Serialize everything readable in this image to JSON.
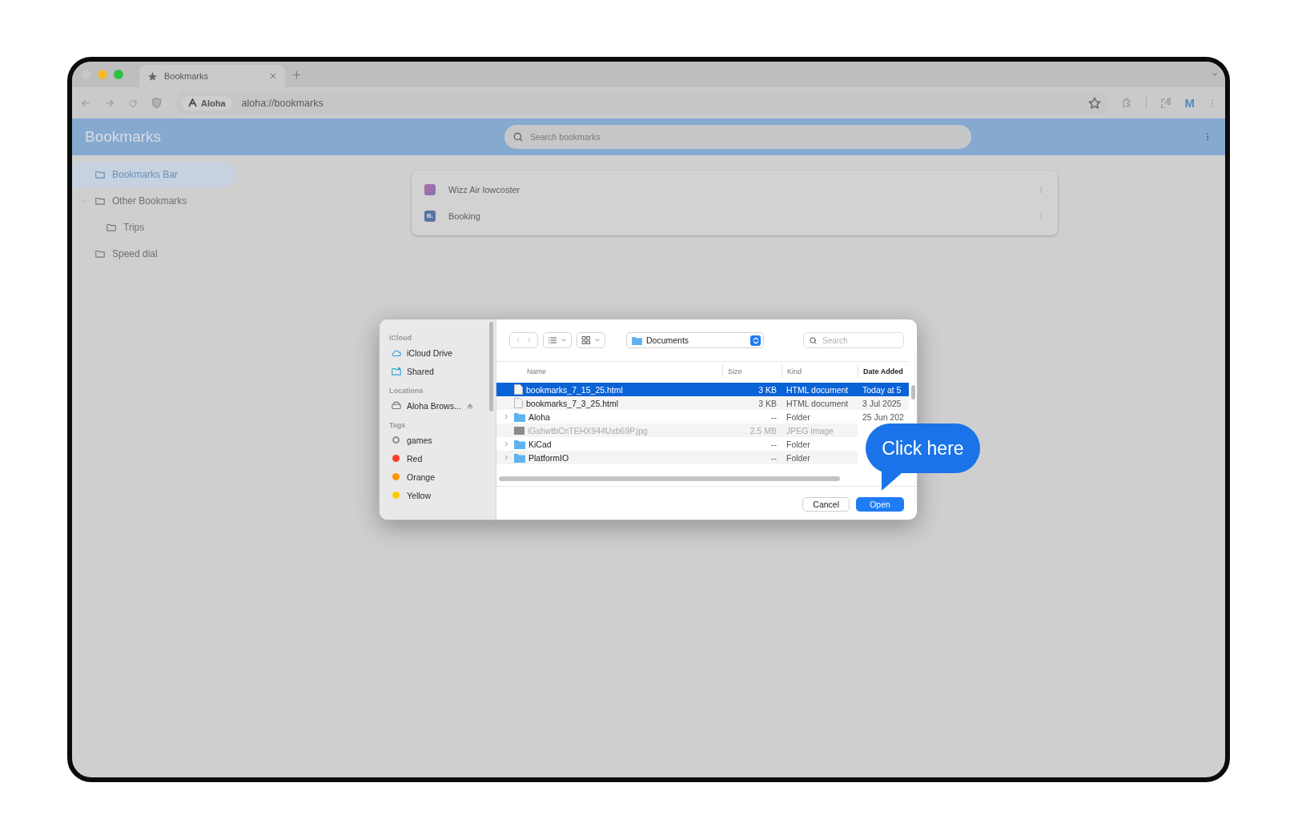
{
  "browser": {
    "tabs": [
      {
        "label": "Bookmarks",
        "selected": true
      }
    ],
    "site_chip": "Aloha",
    "url": "aloha://bookmarks",
    "profile": "M"
  },
  "bookmarks_page": {
    "title": "Bookmarks",
    "search": {
      "placeholder": "Search bookmarks"
    },
    "folders": [
      {
        "label": "Bookmarks Bar",
        "selected": true,
        "expanded": false
      },
      {
        "label": "Other Bookmarks",
        "selected": false,
        "expanded": true,
        "children": [
          {
            "label": "Trips",
            "selected": false,
            "expanded": false
          }
        ]
      },
      {
        "label": "Speed dial",
        "selected": false,
        "expanded": false
      }
    ],
    "items": [
      {
        "title": "Wizz Air lowcoster",
        "kind": "wizz"
      },
      {
        "title": "Booking",
        "kind": "letter",
        "badge": "B."
      }
    ]
  },
  "dialog": {
    "sidebar": [
      {
        "heading": "iCloud",
        "items": [
          {
            "label": "iCloud Drive",
            "kind": "cloud"
          },
          {
            "label": "Shared",
            "kind": "shared"
          }
        ]
      },
      {
        "heading": "Locations",
        "items": [
          {
            "label": "Aloha Brows...",
            "kind": "disk"
          }
        ]
      },
      {
        "heading": "Tags",
        "items": [
          {
            "label": "games",
            "kind": "tag",
            "color": "#8e8e8e"
          },
          {
            "label": "Red",
            "kind": "tag",
            "color": "#fe3b30"
          },
          {
            "label": "Orange",
            "kind": "tag",
            "color": "#fe9500"
          },
          {
            "label": "Yellow",
            "kind": "tag",
            "color": "#fecc00"
          }
        ]
      }
    ],
    "location": "Documents",
    "search": {
      "placeholder": "Search"
    },
    "columns": [
      "Name",
      "Size",
      "Kind",
      "Date Added"
    ],
    "rows": [
      {
        "name": "bookmarks_7_15_25.html",
        "size": "3 KB",
        "kind_text": "HTML document",
        "date": "Today at 5",
        "kind": "file",
        "selected": true,
        "disabled": false
      },
      {
        "name": "bookmarks_7_3_25.html",
        "size": "3 KB",
        "kind_text": "HTML document",
        "date": "3 Jul 2025",
        "kind": "file",
        "selected": false,
        "disabled": false
      },
      {
        "name": "Aloha",
        "size": "--",
        "kind_text": "Folder",
        "date": "25 Jun 202",
        "kind": "folder",
        "selected": false,
        "disabled": false
      },
      {
        "name": "iGshwtbCnTEHX944Uxb69P.jpg",
        "size": "2.5 MB",
        "kind_text": "JPEG image",
        "kind": "image",
        "selected": false,
        "disabled": true
      },
      {
        "name": "KiCad",
        "size": "--",
        "kind_text": "Folder",
        "kind": "folder",
        "selected": false,
        "disabled": false
      },
      {
        "name": "PlatformIO",
        "size": "--",
        "kind_text": "Folder",
        "kind": "folder",
        "selected": false,
        "disabled": false
      }
    ],
    "buttons": [
      {
        "label": "Cancel",
        "kind": "secondary"
      },
      {
        "label": "Open",
        "kind": "primary"
      }
    ]
  },
  "callout": {
    "text": "Click here"
  }
}
